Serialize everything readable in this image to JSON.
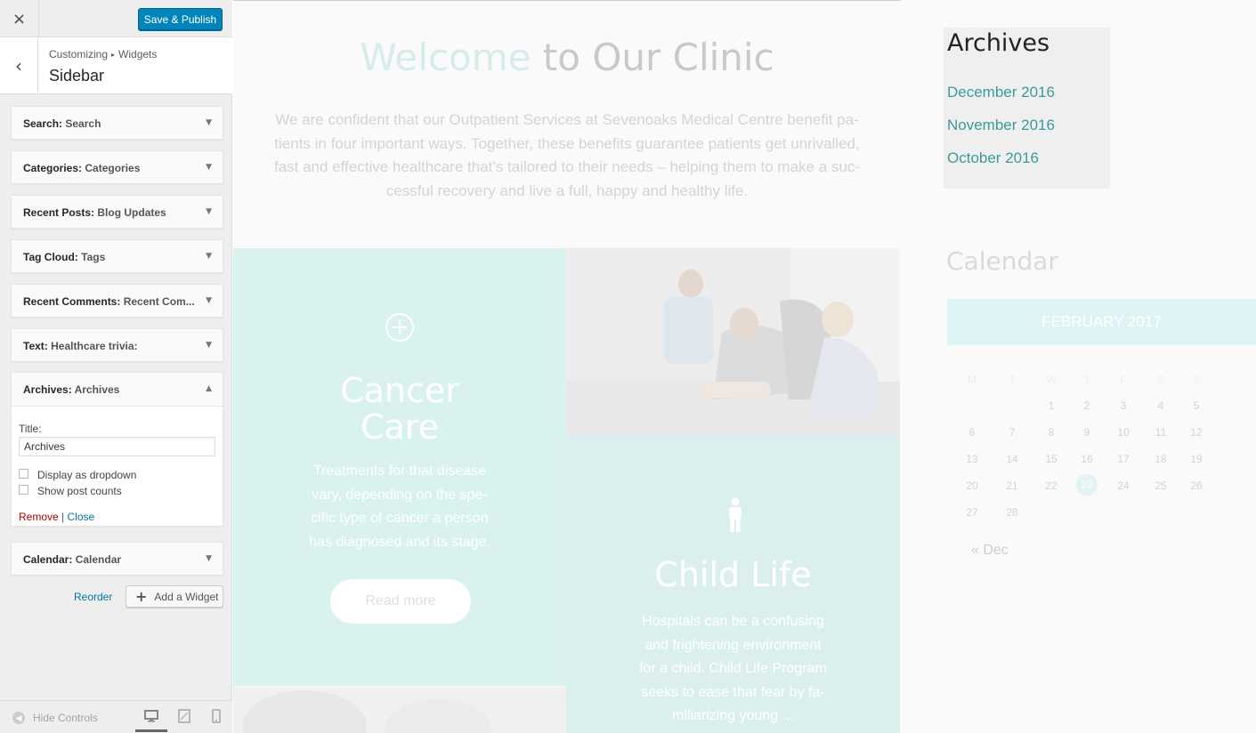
{
  "header": {
    "close_label": "×",
    "publish_label": "Save & Publish"
  },
  "section": {
    "breadcrumb_root": "Customizing",
    "breadcrumb_sep": "▸",
    "breadcrumb_leaf": "Widgets",
    "title": "Sidebar",
    "back_glyph": "‹"
  },
  "widgets": [
    {
      "type": "Search",
      "name": "Search"
    },
    {
      "type": "Categories",
      "name": "Categories"
    },
    {
      "type": "Recent Posts",
      "name": "Blog Updates"
    },
    {
      "type": "Tag Cloud",
      "name": "Tags"
    },
    {
      "type": "Recent Comments",
      "name": "Recent Com..."
    },
    {
      "type": "Text",
      "name": "Healthcare trivia:"
    },
    {
      "type": "Archives",
      "name": "Archives",
      "expanded": true
    },
    {
      "type": "Calendar",
      "name": "Calendar"
    }
  ],
  "archives_form": {
    "title_label": "Title:",
    "title_value": "Archives",
    "dropdown_label": "Display as dropdown",
    "dropdown_checked": false,
    "counts_label": "Show post counts",
    "counts_checked": false,
    "remove_label": "Remove",
    "separator": "|",
    "close_label": "Close"
  },
  "footer_actions": {
    "reorder_label": "Reorder",
    "add_widget_label": "Add a Widget"
  },
  "footer": {
    "hide_controls_label": "Hide Controls",
    "devices": [
      "desktop",
      "tablet",
      "mobile"
    ],
    "active_device": "desktop"
  },
  "preview": {
    "welcome_accent": "Welcome",
    "welcome_rest": " to Our Clinic",
    "intro_lines": [
      "We are confident that our Outpatient Services at Sevenoaks Medical Centre benefit pa-",
      "tients in four important ways. Together, these benefits guarantee patients get unrivalled,",
      "fast and effective healthcare that’s tailored to their needs – helping them to make a suc-",
      "cessful recovery and live a full, happy and healthy life."
    ],
    "cancer": {
      "title_line1": "Cancer",
      "title_line2": "Care",
      "text_lines": [
        "Treatments for that disease",
        "vary, depending on the spe-",
        "cific type of cancer a person",
        "has diagnosed and its stage."
      ],
      "button": "Read more"
    },
    "child": {
      "title": "Child Life",
      "text_lines": [
        "Hospitals can be a confusing",
        "and frightening environment",
        "for a child. Child Life Program",
        "seeks to ease that fear by fa-",
        "miliarizing young ..."
      ]
    },
    "archives": {
      "title": "Archives",
      "links": [
        "December 2016",
        "November 2016",
        "October 2016"
      ]
    },
    "calendar": {
      "title": "Calendar",
      "month": "FEBRUARY 2017",
      "weekdays": [
        "M",
        "T",
        "W",
        "T",
        "F",
        "S",
        "S"
      ],
      "weeks": [
        [
          "",
          "",
          "1",
          "2",
          "3",
          "4",
          "5"
        ],
        [
          "6",
          "7",
          "8",
          "9",
          "10",
          "11",
          "12"
        ],
        [
          "13",
          "14",
          "15",
          "16",
          "17",
          "18",
          "19"
        ],
        [
          "20",
          "21",
          "22",
          "23",
          "24",
          "25",
          "26"
        ],
        [
          "27",
          "28",
          "",
          "",
          "",
          "",
          ""
        ]
      ],
      "today": "23",
      "prev_link": "« Dec"
    }
  }
}
